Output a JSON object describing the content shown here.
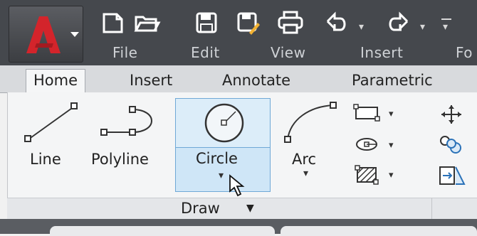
{
  "menu": {
    "items": [
      "File",
      "Edit",
      "View",
      "Insert",
      "Fo"
    ]
  },
  "tabs": [
    {
      "label": "Home",
      "active": true
    },
    {
      "label": "Insert",
      "active": false
    },
    {
      "label": "Annotate",
      "active": false
    },
    {
      "label": "Parametric",
      "active": false
    }
  ],
  "draw_panel": {
    "title": "Draw",
    "tools": {
      "line": "Line",
      "polyline": "Polyline",
      "circle": "Circle",
      "arc": "Arc"
    }
  },
  "icons": {
    "app": "autocad-logo-icon",
    "new": "new-file-icon",
    "open": "open-folder-icon",
    "save": "save-icon",
    "saveas": "save-as-icon",
    "print": "print-icon",
    "undo": "undo-icon",
    "redo": "redo-icon",
    "rectangle": "rectangle-icon",
    "hatch": "hatch-icon",
    "ellipse": "ellipse-icon",
    "move": "move-icon",
    "copy": "copy-icon",
    "cursor": "mouse-cursor-icon"
  },
  "colors": {
    "qat_bg": "#45484d",
    "selection": "#cfe6f7",
    "accent_red": "#d3242b"
  }
}
